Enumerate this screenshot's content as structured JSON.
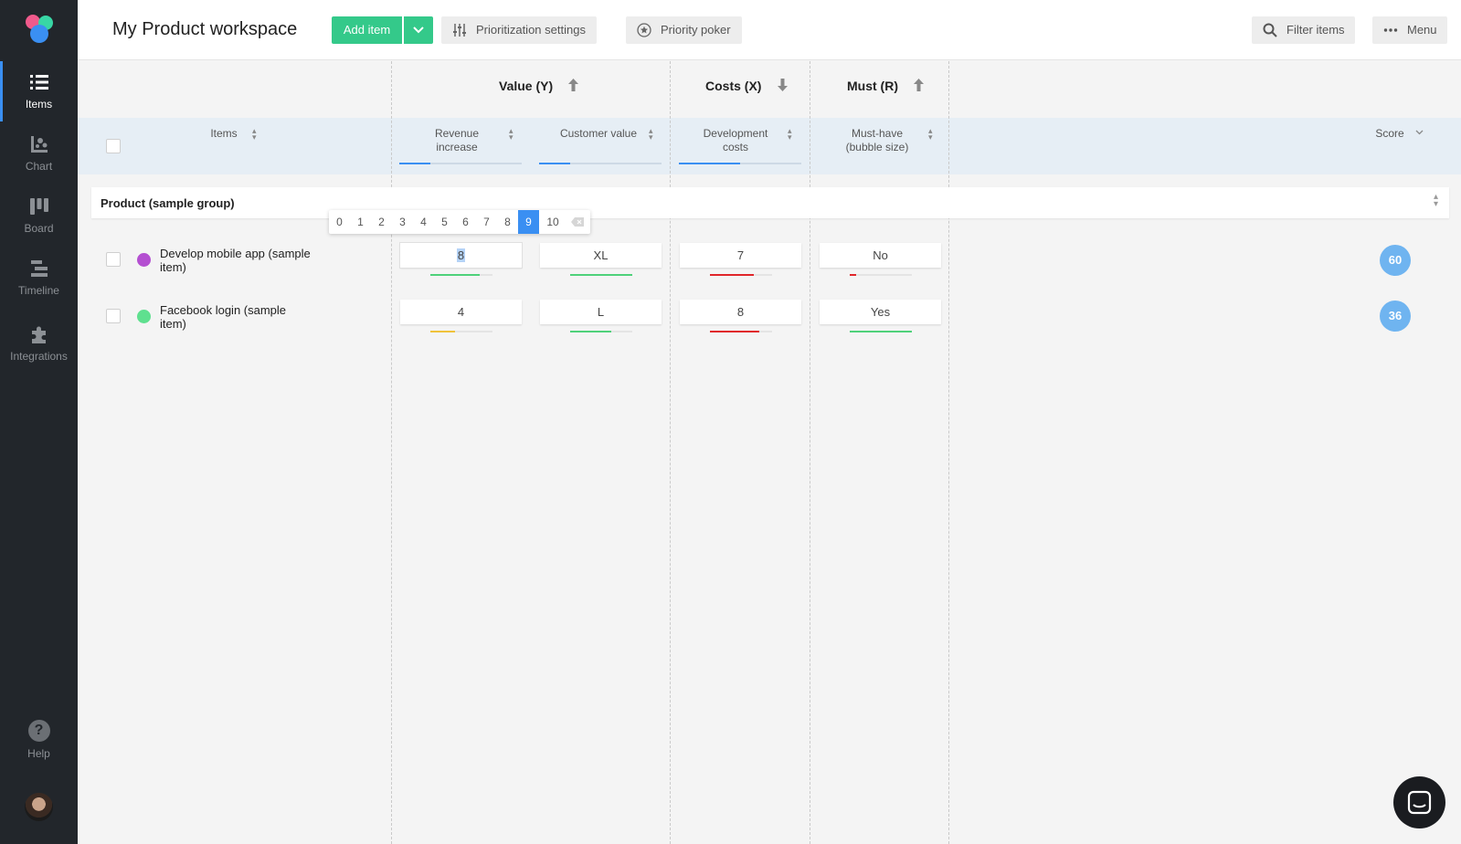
{
  "sidebar": {
    "items": [
      {
        "label": "Items",
        "icon": "list-icon"
      },
      {
        "label": "Chart",
        "icon": "chart-icon"
      },
      {
        "label": "Board",
        "icon": "board-icon"
      },
      {
        "label": "Timeline",
        "icon": "timeline-icon"
      },
      {
        "label": "Integrations",
        "icon": "puzzle-icon"
      }
    ],
    "help_label": "Help",
    "help_glyph": "?"
  },
  "header": {
    "title": "My Product workspace",
    "add_item": "Add item",
    "prioritization_settings": "Prioritization settings",
    "priority_poker": "Priority poker",
    "filter_items": "Filter items",
    "menu": "Menu"
  },
  "groups": {
    "value": "Value (Y)",
    "costs": "Costs (X)",
    "must": "Must (R)"
  },
  "columns": {
    "items": "Items",
    "revenue": [
      "Revenue",
      "increase"
    ],
    "customer_value": "Customer value",
    "dev_costs": [
      "Development",
      "costs"
    ],
    "must_have": [
      "Must-have",
      "(bubble size)"
    ],
    "score": "Score"
  },
  "column_weights": {
    "revenue": 0.25,
    "customer_value": 0.25,
    "dev_costs": 0.5
  },
  "group_row": {
    "name": "Product (sample group)"
  },
  "picker": {
    "options": [
      "0",
      "1",
      "2",
      "3",
      "4",
      "5",
      "6",
      "7",
      "8",
      "9",
      "10"
    ],
    "selected": "9"
  },
  "rows": [
    {
      "name": [
        "Develop mobile app (sample",
        "item)"
      ],
      "dot_color": "#b44fd1",
      "revenue": "8",
      "customer_value": "XL",
      "dev_costs": "7",
      "must_have": "No",
      "levels": {
        "revenue": 0.8,
        "customer_value": 1.0,
        "dev_costs": 0.7,
        "must_have": 0.1
      },
      "score": "60"
    },
    {
      "name": [
        "Facebook login (sample",
        "item)"
      ],
      "dot_color": "#5fe08f",
      "revenue": "4",
      "customer_value": "L",
      "dev_costs": "8",
      "must_have": "Yes",
      "levels": {
        "revenue": 0.4,
        "customer_value": 0.66,
        "dev_costs": 0.8,
        "must_have": 1.0
      },
      "score": "36"
    }
  ],
  "colors": {
    "accent": "#3a8ff2",
    "green": "#34c98a",
    "red": "#e0262b",
    "yellow": "#f0c23a",
    "bar_green": "#4fd17a"
  }
}
